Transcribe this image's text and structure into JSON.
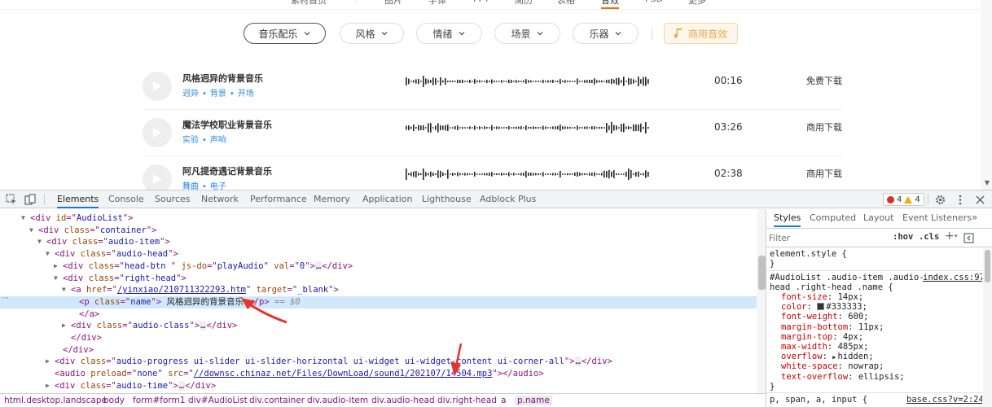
{
  "top_nav": {
    "items": [
      {
        "label": "素材首页",
        "active": false
      },
      {
        "label": "图片",
        "active": false
      },
      {
        "label": "字体",
        "active": false
      },
      {
        "label": "PPT",
        "active": false
      },
      {
        "label": "简历",
        "active": false
      },
      {
        "label": "表格",
        "active": false
      },
      {
        "label": "音效",
        "active": true
      },
      {
        "label": "PSD",
        "active": false
      },
      {
        "label": "更多",
        "active": false
      }
    ]
  },
  "filters": {
    "items": [
      {
        "label": "音乐配乐"
      },
      {
        "label": "风格"
      },
      {
        "label": "情绪"
      },
      {
        "label": "场景"
      },
      {
        "label": "乐器"
      }
    ],
    "commercial": "商用音效"
  },
  "audio_list": [
    {
      "name": "风格迥异的背景音乐",
      "tags": [
        "迥异",
        "背景",
        "开场"
      ],
      "duration": "00:16",
      "download": "免费下载"
    },
    {
      "name": "魔法学校职业背景音乐",
      "tags": [
        "实验",
        "声响"
      ],
      "duration": "03:26",
      "download": "商用下载"
    },
    {
      "name": "阿凡提奇遇记背景音乐",
      "tags": [
        "舞曲",
        "电子"
      ],
      "duration": "02:38",
      "download": "商用下载"
    }
  ],
  "devtools": {
    "tabs": [
      "Elements",
      "Console",
      "Sources",
      "Network",
      "Performance",
      "Memory",
      "Application",
      "Lighthouse",
      "Adblock Plus"
    ],
    "active_tab": "Elements",
    "errors": "4",
    "warnings": "4",
    "dom": [
      {
        "tri": "▼",
        "open": "div",
        "attrs": [
          [
            "id",
            "AudioList"
          ]
        ],
        "end": ">"
      },
      {
        "tri": "▼",
        "open": "div",
        "attrs": [
          [
            "class",
            "container"
          ]
        ],
        "end": ">"
      },
      {
        "tri": "▼",
        "open": "div",
        "attrs": [
          [
            "class",
            "audio-item"
          ]
        ],
        "end": ">"
      },
      {
        "tri": "▼",
        "open": "div",
        "attrs": [
          [
            "class",
            "audio-head"
          ]
        ],
        "end": ">"
      },
      {
        "tri": "▶",
        "open": "div",
        "attrs": [
          [
            "class",
            "head-btn "
          ],
          [
            "js-do",
            "playAudio"
          ],
          [
            "val",
            "0"
          ]
        ],
        "end": ">",
        "collapsed": "div"
      },
      {
        "tri": "▼",
        "open": "div",
        "attrs": [
          [
            "class",
            "right-head"
          ]
        ],
        "end": ">"
      },
      {
        "tri": "▼",
        "open": "a",
        "attrs": [
          [
            "href",
            "/yinxiao/210711322293.htm"
          ],
          [
            "target",
            "_blank"
          ]
        ],
        "end": ">",
        "link_attr": "href"
      },
      {
        "tri": "",
        "open": "p",
        "attrs": [
          [
            "class",
            "name"
          ]
        ],
        "end": ">",
        "text": " 风格迥异的背景音乐 ",
        "close": "p",
        "comment": " == $0",
        "selected": true
      },
      {
        "tri": "",
        "close_only": "a"
      },
      {
        "tri": "▶",
        "open": "div",
        "attrs": [
          [
            "class",
            "audio-class"
          ]
        ],
        "end": ">",
        "collapsed": "div"
      },
      {
        "tri": "",
        "close_only": "div"
      },
      {
        "tri": "",
        "close_only": "div"
      },
      {
        "tri": "▶",
        "open": "div",
        "attrs": [
          [
            "class",
            "audio-progress ui-slider ui-slider-horizontal ui-widget ui-widget-content ui-corner-all"
          ]
        ],
        "end": ">",
        "collapsed": "div"
      },
      {
        "tri": "",
        "open": "audio",
        "attrs": [
          [
            "preload",
            "none"
          ],
          [
            "src",
            "//downsc.chinaz.net/Files/DownLoad/sound1/202107/14504.mp3"
          ]
        ],
        "end": ">",
        "close": "audio",
        "link_attr": "src"
      },
      {
        "tri": "▶",
        "open": "div",
        "attrs": [
          [
            "class",
            "audio-time"
          ]
        ],
        "end": ">",
        "collapsed": "div"
      }
    ],
    "breadcrumbs": [
      "html.desktop.landscape",
      "body",
      "form#form1",
      "div#AudioList",
      "div.container",
      "div.audio-item",
      "div.audio-head",
      "div.right-head",
      "a",
      "p.name"
    ]
  },
  "styles": {
    "tabs": [
      "Styles",
      "Computed",
      "Layout",
      "Event Listeners"
    ],
    "active_tab": "Styles",
    "filter_placeholder": "Filter",
    "hov": ":hov",
    "cls": ".cls",
    "element_style": "element.style {",
    "element_style_close": "}",
    "rule_selector_1": "#AudioList .audio-item .audio-",
    "rule_selector_2": "head .right-head .name {",
    "rule_source": "index.css:97",
    "declarations": [
      {
        "prop": "font-size",
        "value": "14px"
      },
      {
        "prop": "color",
        "value": "#333333",
        "swatch": "#333333"
      },
      {
        "prop": "font-weight",
        "value": "600"
      },
      {
        "prop": "margin-bottom",
        "value": "11px"
      },
      {
        "prop": "margin-top",
        "value": "4px"
      },
      {
        "prop": "max-width",
        "value": "485px"
      },
      {
        "prop": "overflow",
        "value": "hidden",
        "expand": true
      },
      {
        "prop": "white-space",
        "value": "nowrap"
      },
      {
        "prop": "text-overflow",
        "value": "ellipsis"
      }
    ],
    "rule_close": "}",
    "next_selector": "p, span, a, input {",
    "next_source": "base.css?v=2:24"
  },
  "colors": {
    "accent": "#1a73e8",
    "link": "#2a8ae8",
    "arrow": "#e8322a"
  }
}
